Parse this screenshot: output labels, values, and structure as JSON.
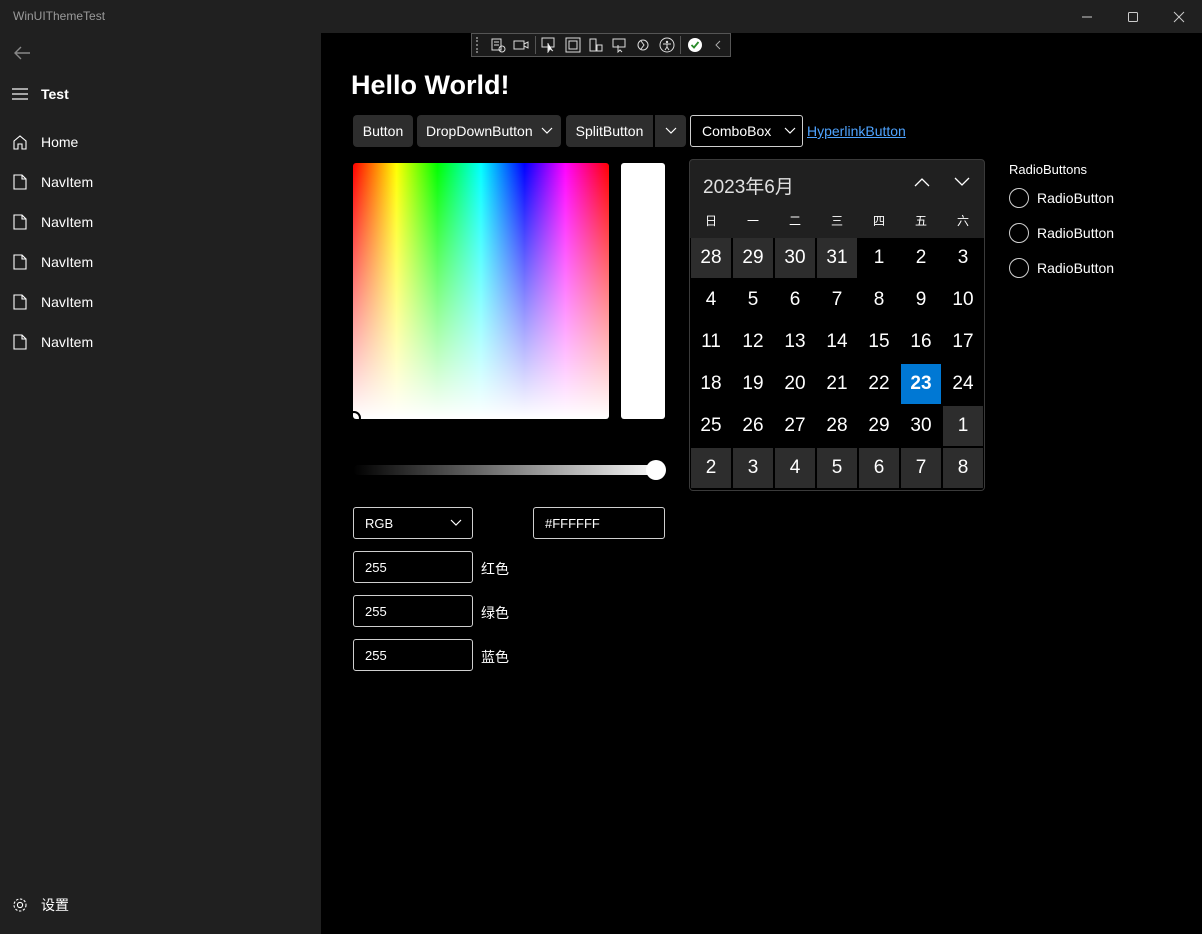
{
  "window": {
    "title": "WinUIThemeTest"
  },
  "sidebar": {
    "header": "Test",
    "items": [
      {
        "label": "Home",
        "icon": "home-icon"
      },
      {
        "label": "NavItem",
        "icon": "document-icon"
      },
      {
        "label": "NavItem",
        "icon": "document-icon"
      },
      {
        "label": "NavItem",
        "icon": "document-icon"
      },
      {
        "label": "NavItem",
        "icon": "document-icon"
      },
      {
        "label": "NavItem",
        "icon": "document-icon"
      }
    ],
    "settings_label": "设置"
  },
  "main": {
    "heading": "Hello World!",
    "buttons": {
      "button": "Button",
      "dropdown": "DropDownButton",
      "split": "SplitButton",
      "combo": "ComboBox",
      "hyperlink": "HyperlinkButton"
    }
  },
  "color_picker": {
    "mode": "RGB",
    "hex": "#FFFFFF",
    "channels": [
      {
        "value": "255",
        "name": "红色"
      },
      {
        "value": "255",
        "name": "绿色"
      },
      {
        "value": "255",
        "name": "蓝色"
      }
    ],
    "selected_color": "#FFFFFF",
    "value_slider": 1.0
  },
  "calendar": {
    "header": "2023年6月",
    "weekdays": [
      "日",
      "一",
      "二",
      "三",
      "四",
      "五",
      "六"
    ],
    "weeks": [
      [
        "28",
        "29",
        "30",
        "31",
        "1",
        "2",
        "3"
      ],
      [
        "4",
        "5",
        "6",
        "7",
        "8",
        "9",
        "10"
      ],
      [
        "11",
        "12",
        "13",
        "14",
        "15",
        "16",
        "17"
      ],
      [
        "18",
        "19",
        "20",
        "21",
        "22",
        "23",
        "24"
      ],
      [
        "25",
        "26",
        "27",
        "28",
        "29",
        "30",
        "1"
      ],
      [
        "2",
        "3",
        "4",
        "5",
        "6",
        "7",
        "8"
      ]
    ],
    "today": "23",
    "accent": "#0078D4"
  },
  "radio_group": {
    "title": "RadioButtons",
    "items": [
      "RadioButton",
      "RadioButton",
      "RadioButton"
    ]
  },
  "colors": {
    "background": "#000000",
    "pane": "#202020",
    "control": "#2D2D2D",
    "link": "#4EA3FF"
  }
}
